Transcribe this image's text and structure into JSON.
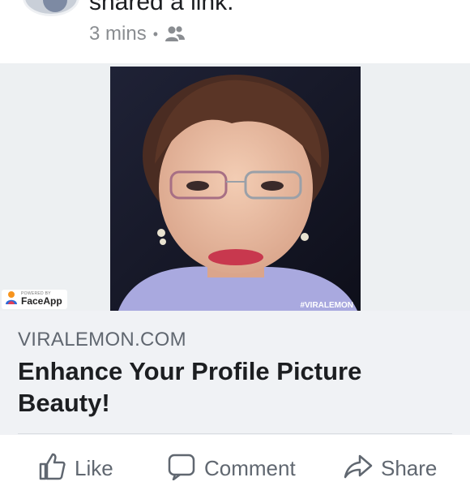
{
  "post": {
    "action_text": "shared a link.",
    "timestamp": "3 mins",
    "separator": "•",
    "privacy_icon": "friends-icon"
  },
  "link": {
    "badge_powered_by": "POWERED BY",
    "badge_name": "FaceApp",
    "watermark": "#VIRALEMON",
    "domain": "VIRALEMON.COM",
    "title": "Enhance Your Profile Picture Beauty!"
  },
  "actions": {
    "like": "Like",
    "comment": "Comment",
    "share": "Share"
  },
  "colors": {
    "media_bg": "#edf0f2",
    "link_bg": "#f0f2f5",
    "meta_text": "#8a8d91"
  }
}
